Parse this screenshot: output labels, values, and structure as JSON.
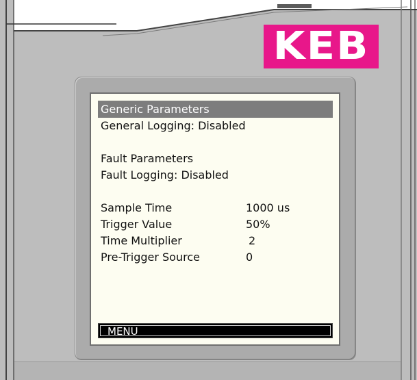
{
  "brand": {
    "logo_text": "KEB",
    "logo_color": "#e8178a"
  },
  "display": {
    "highlight_color": "#7d7d7d",
    "background_color": "#fdfdf1",
    "generic_title": "Generic Parameters",
    "general_logging": "General Logging: Disabled",
    "fault_title": "Fault Parameters",
    "fault_logging": "Fault Logging: Disabled",
    "params": [
      {
        "label": "Sample Time",
        "value": "1000 us"
      },
      {
        "label": "Trigger Value",
        "value": "50%"
      },
      {
        "label": "Time Multiplier",
        "value": "2"
      },
      {
        "label": "Pre-Trigger Source",
        "value": "0"
      }
    ],
    "menu_label": "MENU"
  }
}
